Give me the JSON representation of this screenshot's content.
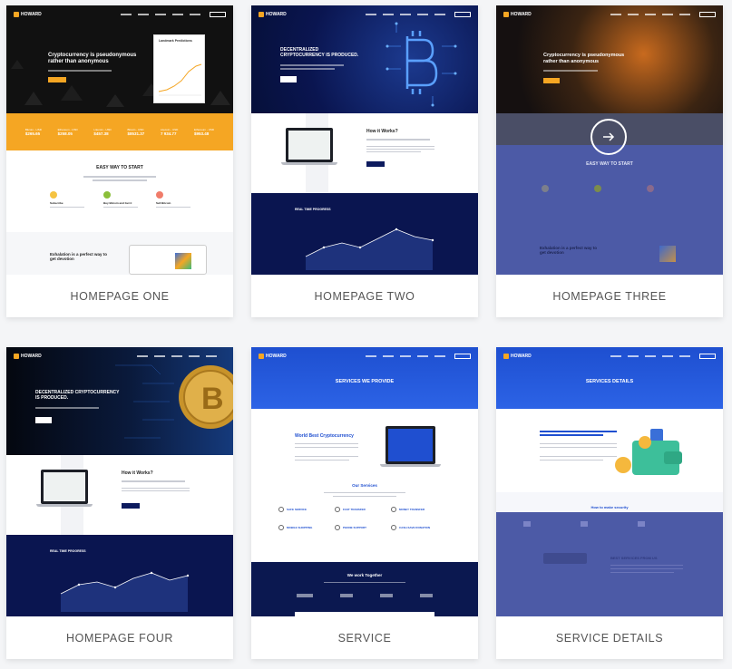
{
  "cards": [
    {
      "label": "HOMEPAGE ONE",
      "hero_heading": "Cryptocurrency is pseudonymous rather than anonymous",
      "chart_title": "Landmark Predictions",
      "stats": [
        {
          "label": "Bitcoin - USD",
          "value": "$265.65"
        },
        {
          "label": "Ethereum - USD",
          "value": "$258.05"
        },
        {
          "label": "Litecoin - USD",
          "value": "$457.38"
        },
        {
          "label": "Bitcoin - USD",
          "value": "$8531.37"
        },
        {
          "label": "Litecoin - USD",
          "value": "7 934.77"
        },
        {
          "label": "Ethereum - USD",
          "value": "$953.48"
        }
      ],
      "section_title": "EASY WAY TO START",
      "features": [
        "Subscribe",
        "Buy Bitcoin and Get it",
        "Sell Bitcoin"
      ],
      "bottom_heading": "Exhalation is a perfect way to get devotion"
    },
    {
      "label": "HOMEPAGE TWO",
      "hero_heading": "DECENTRALIZED CRYPTOCURRENCY IS PRODUCED.",
      "how_title": "How it Works?",
      "chart_title": "REAL TIME PROGRESS"
    },
    {
      "label": "HOMEPAGE THREE",
      "hero_heading": "Cryptocurrency is pseudonymous rather than anonymous",
      "section_title": "EASY WAY TO START",
      "bottom_heading": "Exhalation is a perfect way to get devotion"
    },
    {
      "label": "HOMEPAGE FOUR",
      "hero_heading": "DECENTRALIZED CRYPTOCURRENCY IS PRODUCED.",
      "how_title": "How it Works?",
      "chart_title": "REAL TIME PROGRESS"
    },
    {
      "label": "SERVICE",
      "hero_heading": "SERVICES WE PROVIDE",
      "feature_title": "World Best Cryptocurrency",
      "services_title": "Our Services",
      "services": [
        "SAFE SERVICE",
        "FAST TRANSFER",
        "MONEY TRANSFER",
        "MOBILE SHOPPING",
        "PHONE SUPPORT",
        "CASH-SAVE DONATION"
      ],
      "work_title": "We work Together"
    },
    {
      "label": "SERVICE DETAILS",
      "hero_heading": "SERVICES DETAILS",
      "security_title": "How to make security",
      "best_title": "BEST SERVICES FROM US"
    }
  ]
}
